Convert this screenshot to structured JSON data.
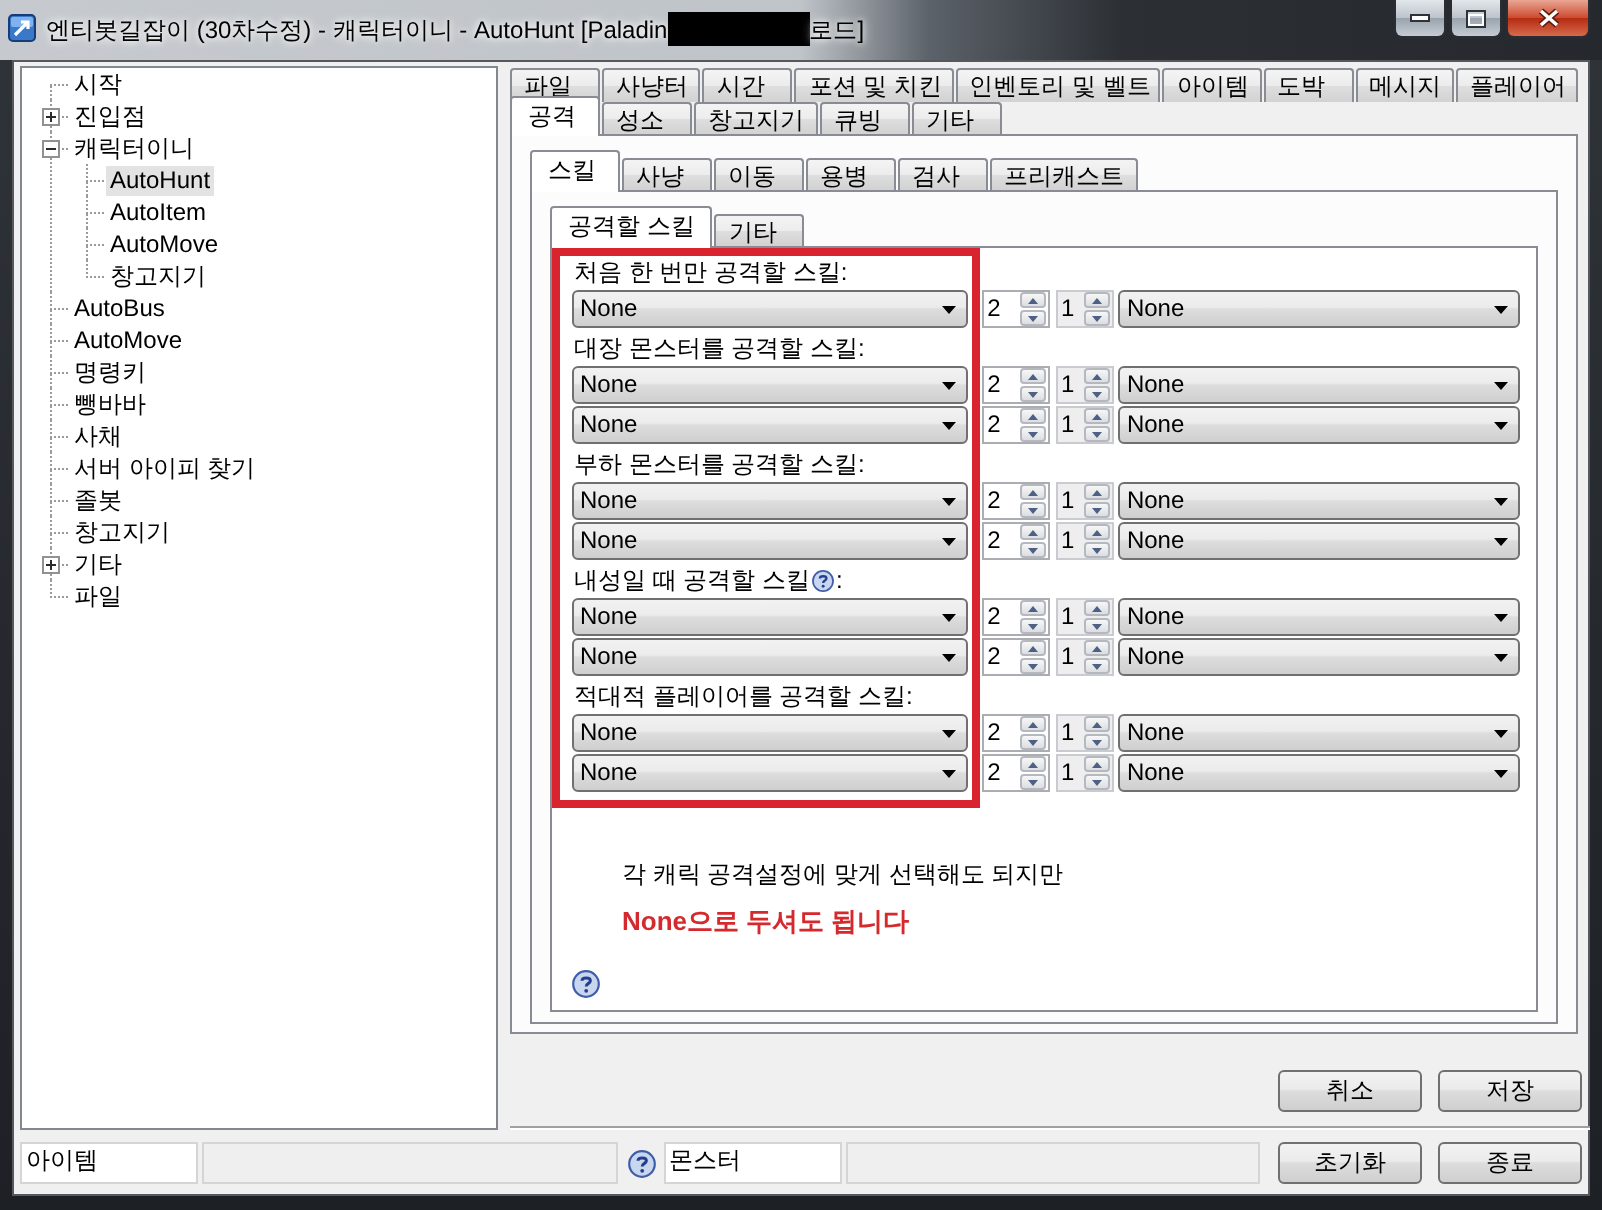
{
  "window": {
    "title": "엔티봇길잡이 (30차수정) - 캐릭터이니 - AutoHunt [Paladin",
    "title_end": "로드]"
  },
  "tree": {
    "items": [
      {
        "label": "시작",
        "selected": false
      },
      {
        "label": "진입점",
        "selected": false,
        "expanded": false
      },
      {
        "label": "캐릭터이니",
        "selected": false,
        "expanded": true,
        "children": [
          {
            "label": "AutoHunt",
            "selected": true
          },
          {
            "label": "AutoItem",
            "selected": false
          },
          {
            "label": "AutoMove",
            "selected": false
          },
          {
            "label": "창고지기",
            "selected": false
          }
        ]
      },
      {
        "label": "AutoBus",
        "selected": false
      },
      {
        "label": "AutoMove",
        "selected": false
      },
      {
        "label": "명령키",
        "selected": false
      },
      {
        "label": "뺑바바",
        "selected": false
      },
      {
        "label": "사채",
        "selected": false
      },
      {
        "label": "서버 아이피 찾기",
        "selected": false
      },
      {
        "label": "졸봇",
        "selected": false
      },
      {
        "label": "창고지기",
        "selected": false
      },
      {
        "label": "기타",
        "selected": false,
        "expanded": false
      },
      {
        "label": "파일",
        "selected": false
      }
    ]
  },
  "tabs": {
    "rows": [
      [
        {
          "label": "파일",
          "selected": false
        },
        {
          "label": "사냥터",
          "selected": false
        },
        {
          "label": "시간",
          "selected": false
        },
        {
          "label": "포션 및 치킨",
          "selected": false
        },
        {
          "label": "인벤토리 및 벨트",
          "selected": false
        },
        {
          "label": "아이템",
          "selected": false
        },
        {
          "label": "도박",
          "selected": false
        },
        {
          "label": "메시지",
          "selected": false
        },
        {
          "label": "플레이어",
          "selected": false
        }
      ],
      [
        {
          "label": "공격",
          "selected": true
        },
        {
          "label": "성소",
          "selected": false
        },
        {
          "label": "창고지기",
          "selected": false
        },
        {
          "label": "큐빙",
          "selected": false
        },
        {
          "label": "기타",
          "selected": false
        }
      ]
    ]
  },
  "sub_tabs": [
    {
      "label": "스킬",
      "selected": true
    },
    {
      "label": "사냥",
      "selected": false
    },
    {
      "label": "이동",
      "selected": false
    },
    {
      "label": "용병",
      "selected": false
    },
    {
      "label": "검사",
      "selected": false
    },
    {
      "label": "프리캐스트",
      "selected": false
    }
  ],
  "inner_tabs": [
    {
      "label": "공격할 스킬",
      "selected": true
    },
    {
      "label": "기타",
      "selected": false
    }
  ],
  "skill_groups": [
    {
      "label": "처음 한 번만 공격할 스킬:",
      "rows": [
        {
          "combo_1": "None",
          "spin_1": "2",
          "spin_2": "1",
          "spin_2_readonly": true,
          "combo_2": "None"
        }
      ]
    },
    {
      "label": "대장 몬스터를 공격할 스킬:",
      "rows": [
        {
          "combo_1": "None",
          "spin_1": "2",
          "spin_2": "1",
          "spin_2_readonly": true,
          "combo_2": "None"
        },
        {
          "combo_1": "None",
          "spin_1": "2",
          "spin_2": "1",
          "spin_2_readonly": true,
          "combo_2": "None"
        }
      ]
    },
    {
      "label": "부하 몬스터를 공격할 스킬:",
      "rows": [
        {
          "combo_1": "None",
          "spin_1": "2",
          "spin_2": "1",
          "spin_2_readonly": true,
          "combo_2": "None"
        },
        {
          "combo_1": "None",
          "spin_1": "2",
          "spin_2": "1",
          "spin_2_readonly": true,
          "combo_2": "None"
        }
      ]
    },
    {
      "label": "내성일 때 공격할 스킬",
      "help_icon": true,
      "label_end": ":",
      "rows": [
        {
          "combo_1": "None",
          "spin_1": "2",
          "spin_2": "1",
          "spin_2_readonly": true,
          "combo_2": "None"
        },
        {
          "combo_1": "None",
          "spin_1": "2",
          "spin_2": "1",
          "spin_2_readonly": true,
          "combo_2": "None"
        }
      ]
    },
    {
      "label": "적대적 플레이어를 공격할 스킬:",
      "rows": [
        {
          "combo_1": "None",
          "spin_1": "2",
          "spin_2": "1",
          "spin_2_readonly": true,
          "combo_2": "None"
        },
        {
          "combo_1": "None",
          "spin_1": "2",
          "spin_2": "1",
          "spin_2_readonly": true,
          "combo_2": "None"
        }
      ]
    }
  ],
  "note": [
    {
      "kind": "plain",
      "text": "각 캐릭 공격설정에 맞게 선택해도 되지만"
    },
    {
      "kind": "emphasis",
      "text": "None으로 두셔도 됩니다"
    }
  ],
  "panel_buttons": [
    "취소",
    "저장"
  ],
  "status_bar": [
    {
      "kind": "field",
      "value": "아이템",
      "readonly": false
    },
    {
      "kind": "field",
      "readonly": true
    },
    {
      "kind": "help"
    },
    {
      "kind": "field",
      "value": "몬스터",
      "readonly": false
    },
    {
      "kind": "field",
      "readonly": true
    }
  ],
  "footer_buttons": [
    "초기화",
    "종료"
  ]
}
